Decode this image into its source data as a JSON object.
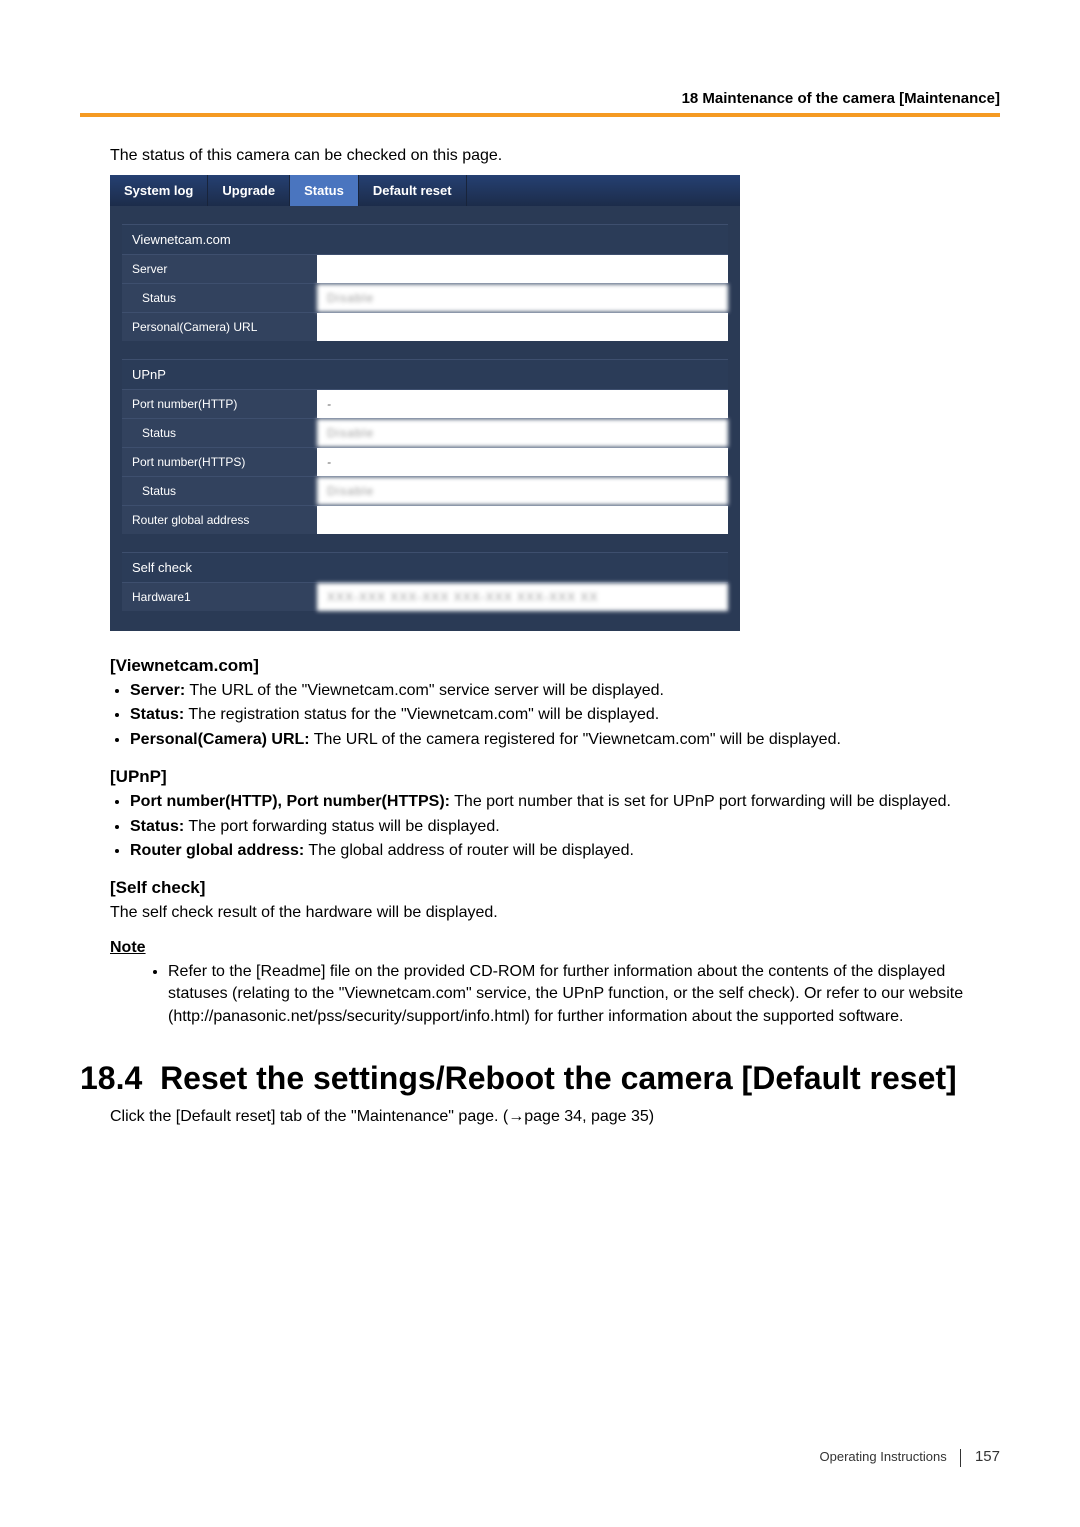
{
  "chapter_header": "18 Maintenance of the camera [Maintenance]",
  "intro": "The status of this camera can be checked on this page.",
  "camera_ui": {
    "tabs": [
      "System log",
      "Upgrade",
      "Status",
      "Default reset"
    ],
    "active_tab_index": 2,
    "sections": [
      {
        "title": "Viewnetcam.com",
        "rows": [
          {
            "label": "Server",
            "value": ""
          },
          {
            "label": "Status",
            "value": "Disable",
            "indent": true,
            "blur": true
          },
          {
            "label": "Personal(Camera) URL",
            "value": ""
          }
        ]
      },
      {
        "title": "UPnP",
        "rows": [
          {
            "label": "Port number(HTTP)",
            "value": "-"
          },
          {
            "label": "Status",
            "value": "Disable",
            "indent": true,
            "blur": true
          },
          {
            "label": "Port number(HTTPS)",
            "value": "-"
          },
          {
            "label": "Status",
            "value": "Disable",
            "indent": true,
            "blur": true
          },
          {
            "label": "Router global address",
            "value": ""
          }
        ]
      },
      {
        "title": "Self check",
        "rows": [
          {
            "label": "Hardware1",
            "value": "XXX-XXX XXX-XXX XXX-XXX XXX-XXX XX",
            "blur": true
          }
        ]
      }
    ]
  },
  "content": {
    "viewnetcam_heading": "[Viewnetcam.com]",
    "viewnetcam_bullets": [
      {
        "b": "Server:",
        "t": " The URL of the \"Viewnetcam.com\" service server will be displayed."
      },
      {
        "b": "Status:",
        "t": " The registration status for the \"Viewnetcam.com\" will be displayed."
      },
      {
        "b": "Personal(Camera) URL:",
        "t": " The URL of the camera registered for \"Viewnetcam.com\" will be displayed."
      }
    ],
    "upnp_heading": "[UPnP]",
    "upnp_bullets": [
      {
        "b": "Port number(HTTP), Port number(HTTPS):",
        "t": " The port number that is set for UPnP port forwarding will be displayed."
      },
      {
        "b": "Status:",
        "t": " The port forwarding status will be displayed."
      },
      {
        "b": "Router global address:",
        "t": " The global address of router will be displayed."
      }
    ],
    "selfcheck_heading": "[Self check]",
    "selfcheck_text": "The self check result of the hardware will be displayed.",
    "note_heading": "Note",
    "note_text": "Refer to the [Readme] file on the provided CD-ROM for further information about the contents of the displayed statuses (relating to the \"Viewnetcam.com\" service, the UPnP function, or the self check). Or refer to our website (http://panasonic.net/pss/security/support/info.html) for further information about the supported software."
  },
  "big_heading": "18.4  Reset the settings/Reboot the camera [Default reset]",
  "big_heading_follow": "Click the [Default reset] tab of the \"Maintenance\" page. (→page 34, page 35)",
  "footer": {
    "label": "Operating Instructions",
    "page": "157"
  }
}
